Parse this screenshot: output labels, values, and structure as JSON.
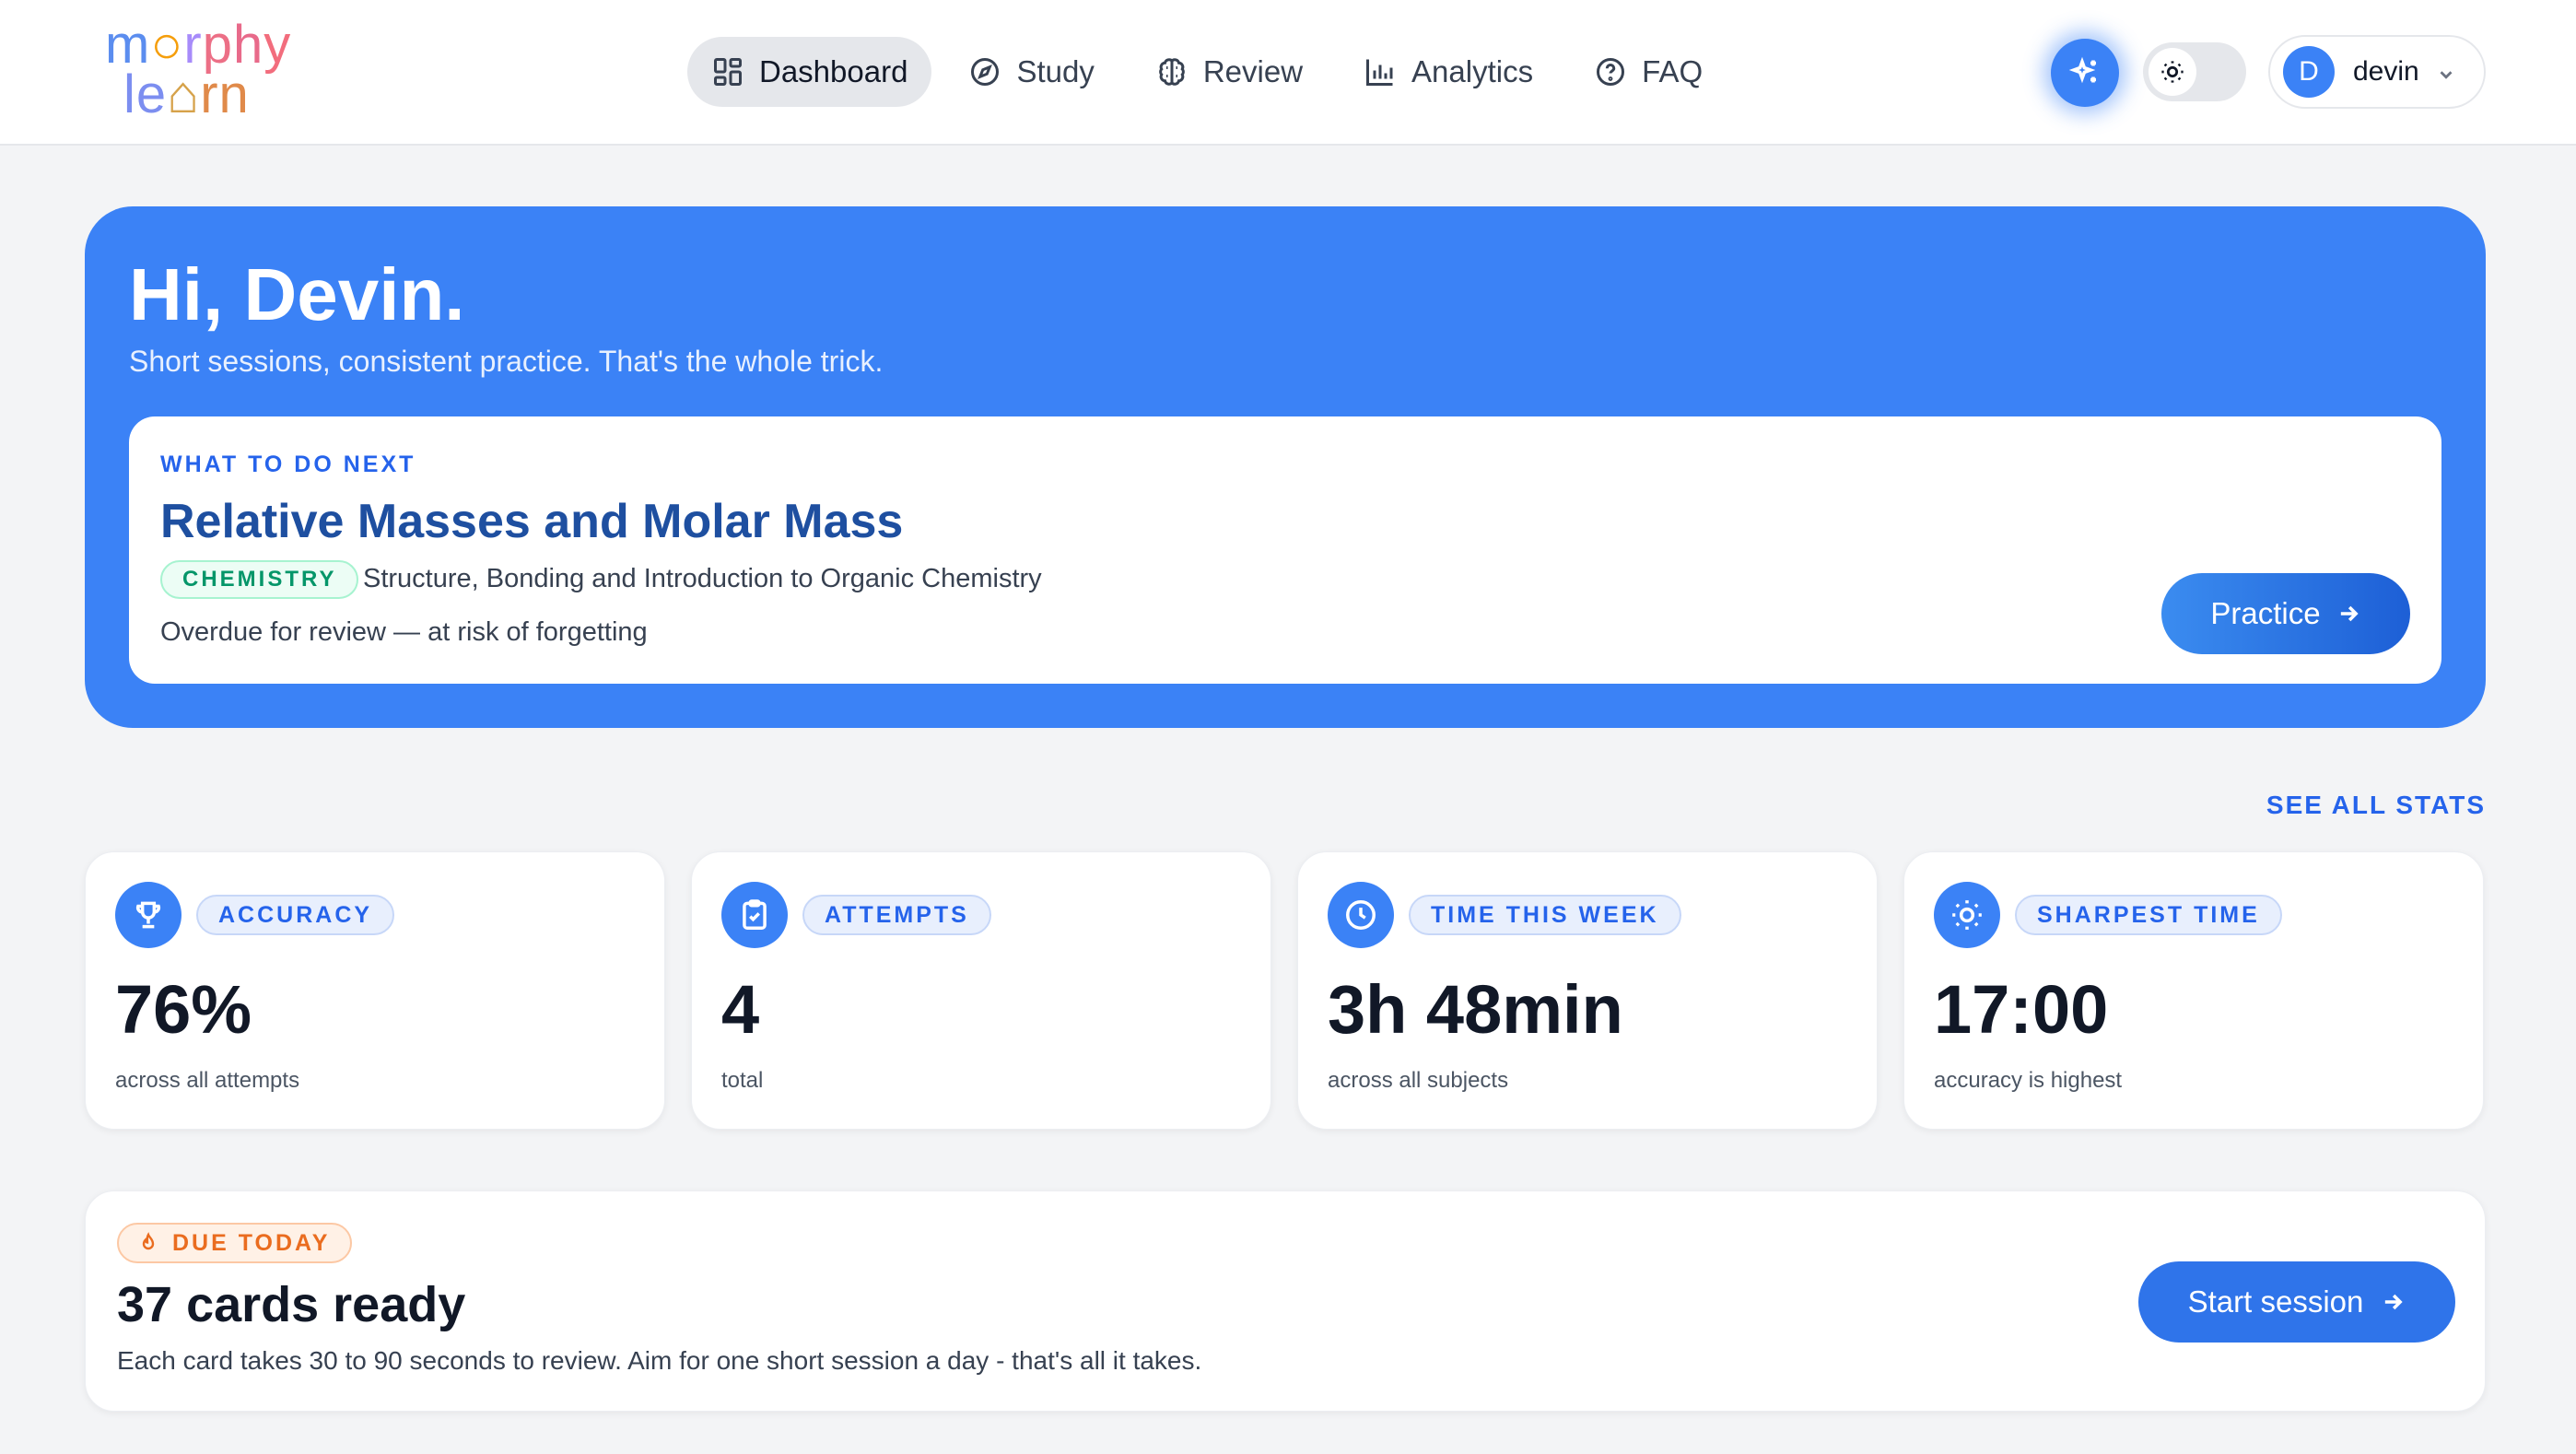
{
  "logo": {
    "line1": "mrphy",
    "line2": "lern"
  },
  "nav": {
    "items": [
      {
        "label": "Dashboard",
        "icon": "dashboard-grid-icon",
        "active": true
      },
      {
        "label": "Study",
        "icon": "compass-icon",
        "active": false
      },
      {
        "label": "Review",
        "icon": "brain-icon",
        "active": false
      },
      {
        "label": "Analytics",
        "icon": "bar-chart-icon",
        "active": false
      },
      {
        "label": "FAQ",
        "icon": "help-circle-icon",
        "active": false
      }
    ]
  },
  "header": {
    "ai_icon": "sparkles-icon",
    "theme_icon": "sun-icon",
    "user": {
      "initial": "D",
      "name": "devin",
      "menu_icon": "chevron-down-icon"
    }
  },
  "hero": {
    "greeting": "Hi, Devin.",
    "tagline": "Short sessions, consistent practice. That's the whole trick.",
    "next": {
      "eyebrow": "WHAT TO DO NEXT",
      "title": "Relative Masses and Molar Mass",
      "subject": "CHEMISTRY",
      "topic": "Structure, Bonding and Introduction to Organic Chemistry",
      "status": "Overdue for review — at risk of forgetting",
      "button": "Practice"
    }
  },
  "stats": {
    "see_all": "SEE ALL STATS",
    "cards": [
      {
        "label": "ACCURACY",
        "value": "76%",
        "sub": "across all attempts",
        "icon": "trophy-icon"
      },
      {
        "label": "ATTEMPTS",
        "value": "4",
        "sub": "total",
        "icon": "clipboard-check-icon"
      },
      {
        "label": "TIME THIS WEEK",
        "value": "3h 48min",
        "sub": "across all subjects",
        "icon": "clock-icon"
      },
      {
        "label": "SHARPEST TIME",
        "value": "17:00",
        "sub": "accuracy is highest",
        "icon": "sun-icon"
      }
    ]
  },
  "due": {
    "tag": "DUE TODAY",
    "tag_icon": "flame-icon",
    "title": "37 cards ready",
    "description": "Each card takes 30 to 90 seconds to review. Aim for one short session a day - that's all it takes.",
    "button": "Start session"
  },
  "colors": {
    "accent": "#3b82f6",
    "hero_bg": "#3b82f6",
    "page_bg": "#f3f4f6",
    "chemistry": "#059669",
    "due": "#ea6c1f"
  }
}
